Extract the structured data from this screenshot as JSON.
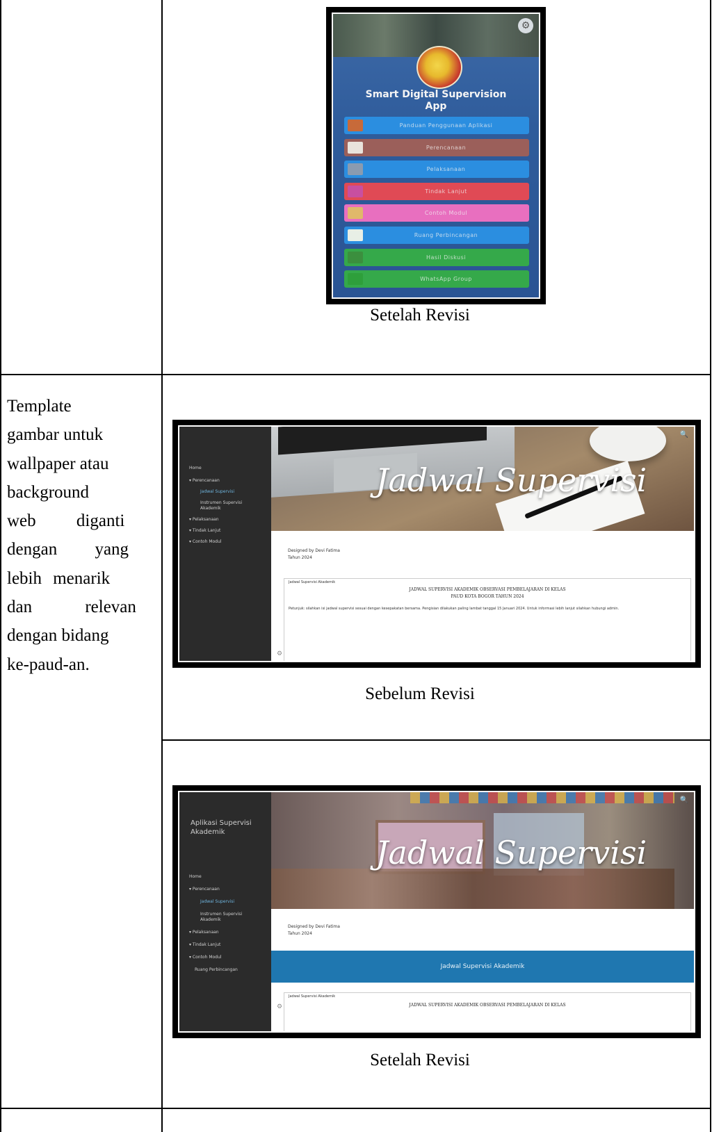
{
  "left_cell": {
    "lines": [
      "Template",
      "gambar untuk",
      "wallpaper atau",
      "background",
      "web diganti",
      "dengan yang",
      "lebih menarik",
      "dan relevan",
      "dengan bidang",
      "ke-paud-an."
    ]
  },
  "captions": {
    "phone_after": "Setelah Revisi",
    "web_before": "Sebelum Revisi",
    "web_after": "Setelah Revisi"
  },
  "phone_app": {
    "title_line1": "Smart Digital Supervision",
    "title_line2": "App",
    "menu": [
      {
        "label": "Panduan Penggunaan Aplikasi",
        "color": "#2b8ee0",
        "icon_color": "#c76a3a",
        "icon": "book-icon"
      },
      {
        "label": "Perencanaan",
        "color": "#9b5f5a",
        "icon_color": "#e9e3dc",
        "icon": "planning-icon"
      },
      {
        "label": "Pelaksanaan",
        "color": "#2b8ee0",
        "icon_color": "#8a9bb0",
        "icon": "implementation-icon"
      },
      {
        "label": "Tindak Lanjut",
        "color": "#e04a55",
        "icon_color": "#c84fa0",
        "icon": "follow-up-icon"
      },
      {
        "label": "Contoh Modul",
        "color": "#e86fbf",
        "icon_color": "#e0b86a",
        "icon": "module-icon"
      },
      {
        "label": "Ruang Perbincangan",
        "color": "#2b8ee0",
        "icon_color": "#e8efe6",
        "icon": "chat-room-icon"
      },
      {
        "label": "Hasil Diskusi",
        "color": "#35a94a",
        "icon_color": "#3b8f3e",
        "icon": "discussion-icon"
      },
      {
        "label": "WhatsApp Group",
        "color": "#35a94a",
        "icon_color": "#2e9f3b",
        "icon": "whatsapp-icon"
      }
    ]
  },
  "web_before": {
    "sidebar": [
      "Home",
      "▾ Perencanaan",
      "Jadwal Supervisi",
      "Instrumen Supervisi Akademik",
      "▾ Pelaksanaan",
      "▾ Tindak Lanjut",
      "▾ Contoh Modul"
    ],
    "hero_title": "Jadwal Supervisi",
    "designed_by": "Designed by Devi Fatima",
    "year": "Tahun 2024",
    "doc_label": "Jadwal Supervisi Akademik",
    "doc_title_1": "JADWAL SUPERVISI AKADEMIK OBSERVASI PEMBELAJARAN DI KELAS",
    "doc_title_2": "PAUD KOTA BOGOR TAHUN 2024",
    "body_text": "Petunjuk: silahkan isi jadwal supervisi sesuai dengan kesepakatan bersama. Pengisian dilakukan paling lambat tanggal 15 Januari 2024. Untuk informasi lebih lanjut silahkan hubungi admin."
  },
  "web_after": {
    "brand": "Aplikasi Supervisi Akademik",
    "sidebar": [
      "Home",
      "▾ Perencanaan",
      "Jadwal Supervisi",
      "Instrumen Supervisi Akademik",
      "▾ Pelaksanaan",
      "▾ Tindak Lanjut",
      "▾ Contoh Modul",
      "Ruang Perbincangan"
    ],
    "hero_title": "Jadwal Supervisi",
    "designed_by": "Designed by Devi Fatima",
    "year": "Tahun 2024",
    "banner": "Jadwal Supervisi Akademik",
    "doc_label": "Jadwal Supervisi Akademik",
    "doc_title_1": "JADWAL SUPERVISI AKADEMIK OBSERVASI PEMBELAJARAN DI KELAS"
  }
}
